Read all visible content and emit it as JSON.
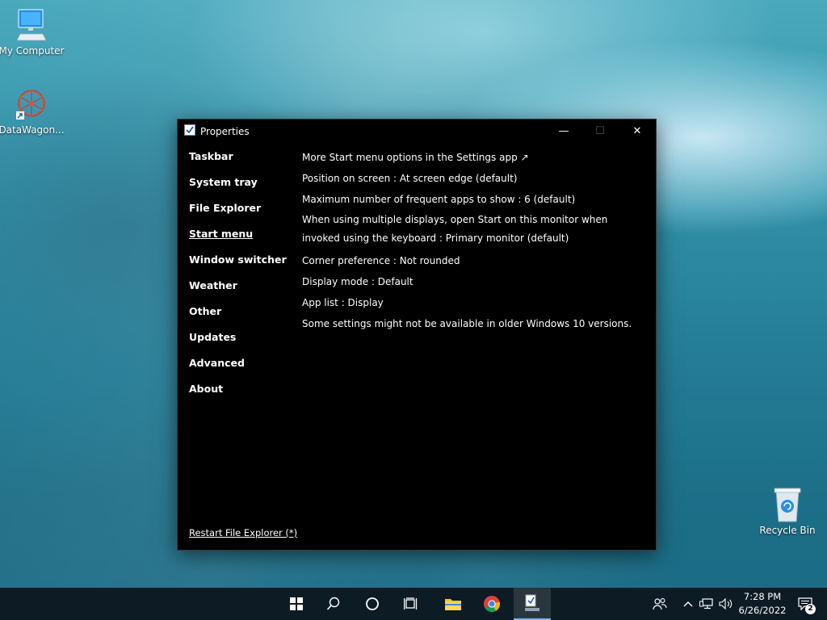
{
  "desktop": {
    "icons": [
      {
        "label": "My Computer"
      },
      {
        "label": "DataWagon..."
      },
      {
        "label": "Recycle Bin"
      }
    ]
  },
  "window": {
    "title": "Properties",
    "controls": {
      "minimize": "—",
      "maximize": "☐",
      "close": "✕"
    },
    "nav": [
      {
        "label": "Taskbar"
      },
      {
        "label": "System tray"
      },
      {
        "label": "File Explorer"
      },
      {
        "label": "Start menu"
      },
      {
        "label": "Window switcher"
      },
      {
        "label": "Weather"
      },
      {
        "label": "Other"
      },
      {
        "label": "Updates"
      },
      {
        "label": "Advanced"
      },
      {
        "label": "About"
      }
    ],
    "active_nav": "Start menu",
    "settings": [
      "More Start menu options in the Settings app ↗",
      "Position on screen : At screen edge (default)",
      "Maximum number of frequent apps to show : 6 (default)",
      "When using multiple displays, open Start on this monitor when invoked using the keyboard : Primary monitor (default)",
      "Corner preference : Not rounded",
      "Display mode : Default",
      "App list : Display",
      "Some settings might not be available in older Windows 10 versions."
    ],
    "restart_link": "Restart File Explorer (*)"
  },
  "taskbar": {
    "clock_time": "7:28 PM",
    "clock_date": "6/26/2022",
    "notification_count": "2",
    "colors": {
      "taskbar_bg": "#0d1b24",
      "active_indicator": "#76b9ed"
    }
  }
}
